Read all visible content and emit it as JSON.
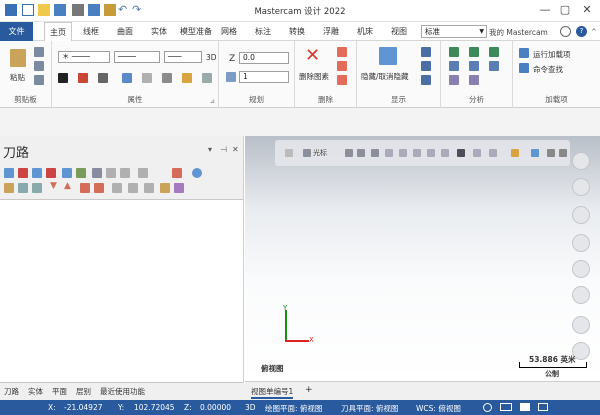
{
  "app": {
    "title": "Mastercam 设计 2022"
  },
  "tabs": [
    {
      "label": "文件",
      "kind": "file"
    },
    {
      "label": "主页",
      "kind": "active"
    },
    {
      "label": "线框",
      "kind": ""
    },
    {
      "label": "曲面",
      "kind": ""
    },
    {
      "label": "实体",
      "kind": ""
    },
    {
      "label": "模型准备",
      "kind": ""
    },
    {
      "label": "网格",
      "kind": ""
    },
    {
      "label": "标注",
      "kind": ""
    },
    {
      "label": "转换",
      "kind": ""
    },
    {
      "label": "浮雕",
      "kind": ""
    },
    {
      "label": "机床",
      "kind": ""
    },
    {
      "label": "视图",
      "kind": ""
    }
  ],
  "header": {
    "style_select": "标准",
    "my_mastercam": "我的 Mastercam"
  },
  "ribbon": {
    "clipboard": {
      "paste": "粘贴",
      "label": "剪贴板"
    },
    "attributes": {
      "label": "属性",
      "dim_3d": "3D"
    },
    "planning": {
      "label": "规划",
      "z_label": "Z",
      "z_value": "0.0",
      "level_value": "1"
    },
    "delete": {
      "label": "删除",
      "delete_entities": "删除图素"
    },
    "display": {
      "label": "显示",
      "hide_unhide": "隐藏/取消隐藏"
    },
    "analyze": {
      "label": "分析"
    },
    "addins": {
      "label": "加载项",
      "run_addin": "运行加载项",
      "find_command": "命令查找"
    }
  },
  "toolpaths": {
    "title": "刀路",
    "pin": "⊣",
    "close": "✕",
    "menu": "▾"
  },
  "bottom_tabs": [
    "刀路",
    "实体",
    "平面",
    "层别",
    "最近使用功能"
  ],
  "viewport": {
    "toolbar_cursor": "光标",
    "view_name": "俯视图",
    "scale_value": "53.886 英米",
    "scale_unit": "公制",
    "axis_x": "X",
    "axis_y": "Y"
  },
  "view_tab": {
    "label": "视图单编号1",
    "add": "+"
  },
  "status": {
    "x_label": "X:",
    "x_value": "-21.04927",
    "y_label": "Y:",
    "y_value": "102.72045",
    "z_label": "Z:",
    "z_value": "0.00000",
    "mode": "3D",
    "drawing_plane": "绘图平面: 俯视图",
    "tool_plane": "刀具平面: 俯视图",
    "wcs": "WCS: 俯视图"
  }
}
